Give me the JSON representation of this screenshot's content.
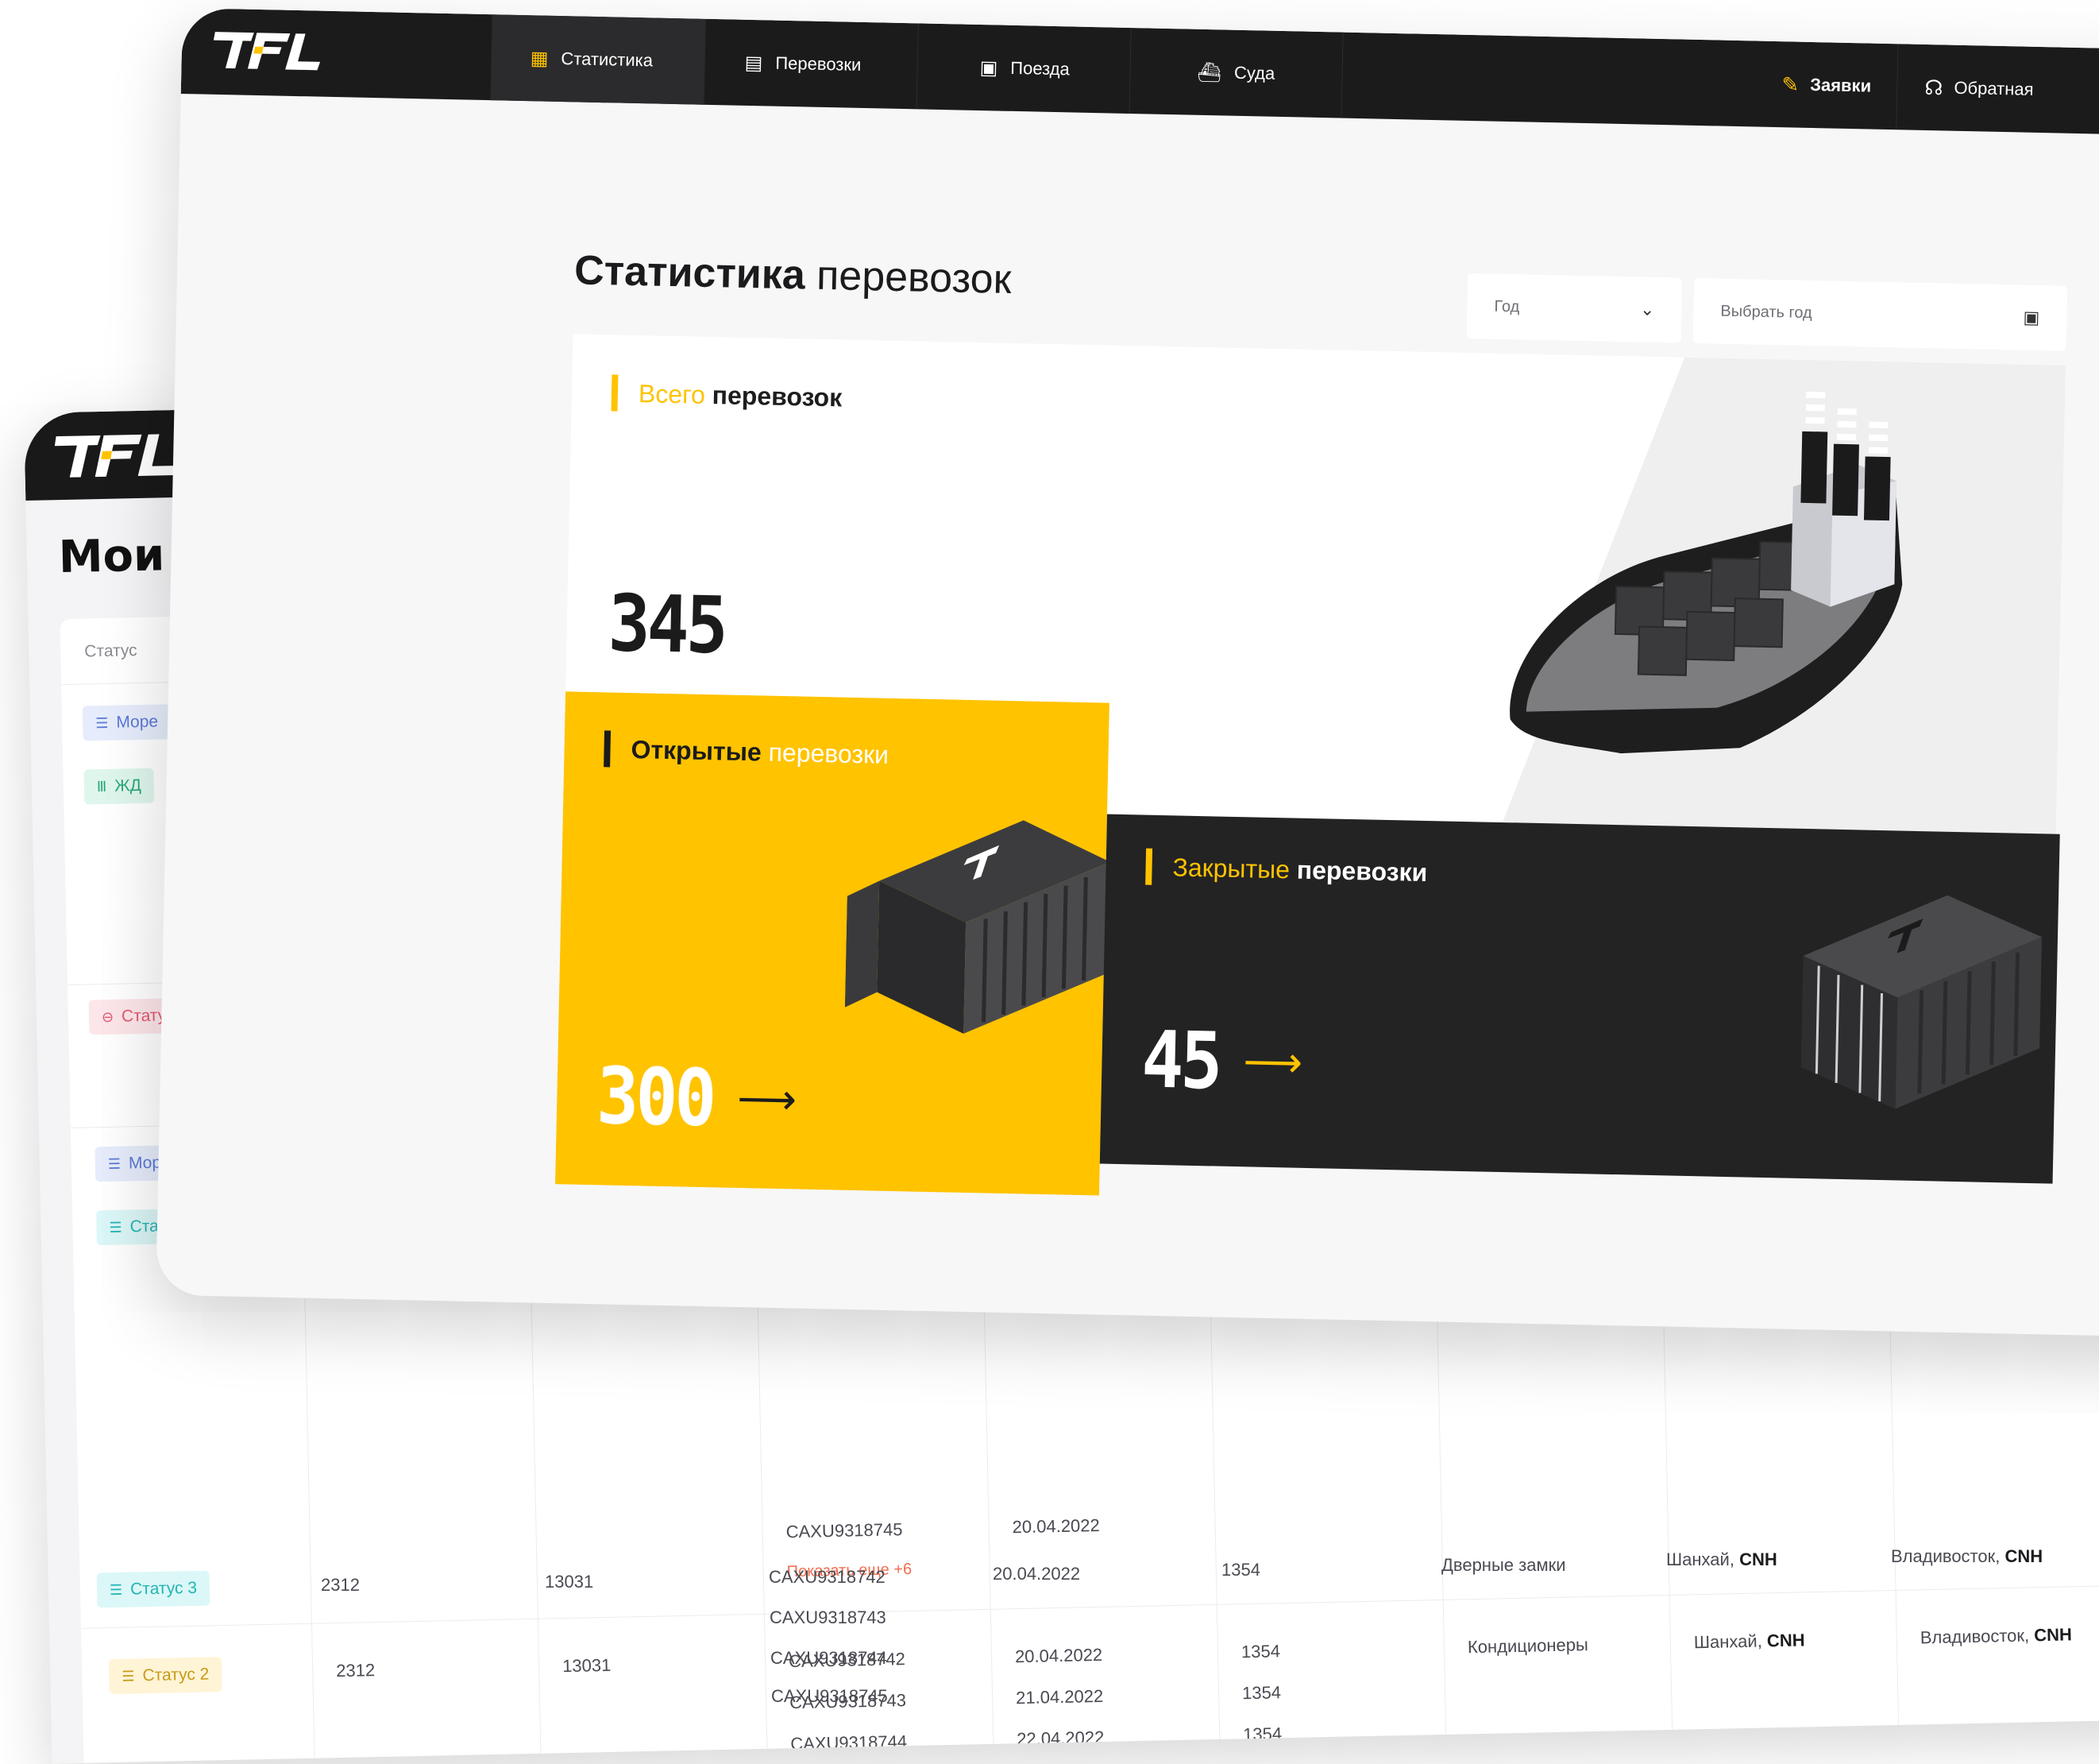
{
  "brand": {
    "logo_text": "TFL",
    "accent": "#ffc300",
    "dark": "#1b1b1c"
  },
  "back": {
    "title": "Мои п",
    "status_header": "Статус",
    "chips_left": [
      {
        "label": "Море",
        "icon": "list-icon"
      },
      {
        "label": "ЖД",
        "icon": "train-icon"
      },
      {
        "label": "Стату",
        "icon": "alert-icon"
      },
      {
        "label": "Мор",
        "icon": "list-icon"
      },
      {
        "label": "Ста",
        "icon": "list-icon"
      }
    ],
    "rows": [
      {
        "containers": [
          "CAXU9318745"
        ],
        "show_more": "Показать еще +6",
        "dates": [
          "20.04.2022"
        ],
        "codes": [
          "1354"
        ]
      },
      {
        "status": "Статус 2",
        "id": "2312",
        "num": "13031",
        "containers": [
          "CAXU9318742",
          "CAXU9318743",
          "CAXU9318744"
        ],
        "dates": [
          "20.04.2022",
          "21.04.2022",
          "22.04.2022"
        ],
        "codes": [
          "1354",
          "1354",
          "1354"
        ],
        "cargo": "Кондиционеры",
        "from_city": "Шанхай,",
        "from_code": "CNH",
        "to_city": "Владивосток,",
        "to_code": "CNH"
      },
      {
        "status": "Статус 3",
        "id": "2312",
        "num": "13031",
        "containers": [
          "CAXU9318742",
          "CAXU9318743",
          "CAXU9318744",
          "CAXU9318745"
        ],
        "dates": [
          "20.04.2022"
        ],
        "codes": [
          "1354"
        ],
        "cargo": "Дверные замки",
        "from_city": "Шанхай,",
        "from_code": "CNH",
        "to_city": "Владивосток,",
        "to_code": "CNH"
      }
    ]
  },
  "nav": {
    "tabs": [
      {
        "label": "Статистика",
        "icon": "dashboard-icon",
        "active": true
      },
      {
        "label": "Перевозки",
        "icon": "container-icon",
        "active": false
      },
      {
        "label": "Поезда",
        "icon": "train-icon",
        "active": false
      },
      {
        "label": "Суда",
        "icon": "ship-icon",
        "active": false
      }
    ],
    "requests": "Заявки",
    "feedback": "Обратная"
  },
  "stats": {
    "title_strong": "Статистика",
    "title_rest": "перевозок",
    "year_select": {
      "label": "Год",
      "icon": "chevron-down-icon"
    },
    "year_picker": {
      "placeholder": "Выбрать год",
      "icon": "calendar-icon"
    },
    "total": {
      "label_accent": "Всего",
      "label_rest": "перевозок",
      "value": "345"
    },
    "open": {
      "label_main": "Открытые",
      "label_accent": "перевозки",
      "value": "300",
      "arrow": "⟶"
    },
    "closed": {
      "label_accent": "Закрытые",
      "label_rest": "перевозки",
      "value": "45",
      "arrow": "⟶"
    }
  }
}
